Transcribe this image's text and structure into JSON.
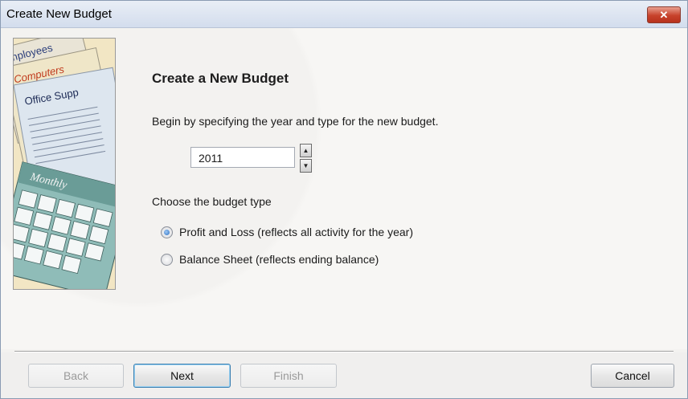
{
  "window": {
    "title": "Create New Budget",
    "close_label": "✕"
  },
  "illustration": {
    "words": [
      "Employees",
      "Computers",
      "Office Supp",
      "Monthly"
    ]
  },
  "main": {
    "heading": "Create a New Budget",
    "intro": "Begin by specifying the year and type for the new budget.",
    "year_value": "2011",
    "type_label": "Choose the budget type",
    "options": [
      {
        "label": "Profit and Loss (reflects all activity for the year)",
        "selected": true
      },
      {
        "label": "Balance Sheet (reflects ending balance)",
        "selected": false
      }
    ]
  },
  "footer": {
    "back": "Back",
    "next": "Next",
    "finish": "Finish",
    "cancel": "Cancel"
  },
  "colors": {
    "title_bar": "#d3dded",
    "close_button": "#c7422b",
    "default_button_border": "#3c7fb1"
  }
}
